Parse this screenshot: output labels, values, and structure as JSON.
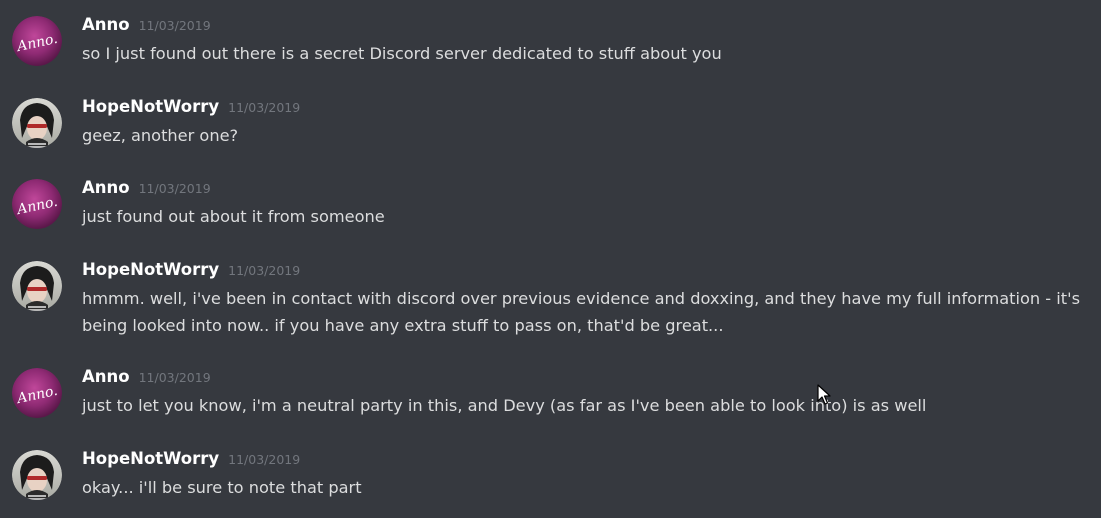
{
  "colors": {
    "background": "#36393f",
    "username": "#ffffff",
    "timestamp": "#72767d",
    "message_text": "#dcddde"
  },
  "messages": [
    {
      "author": "Anno",
      "avatar_icon": "anno-avatar-icon",
      "avatar_text": "Anno.",
      "timestamp": "11/03/2019",
      "text": "so I just found out there is a secret Discord server dedicated to stuff about you"
    },
    {
      "author": "HopeNotWorry",
      "avatar_icon": "hopenotworry-avatar-icon",
      "timestamp": "11/03/2019",
      "text": "geez, another one?"
    },
    {
      "author": "Anno",
      "avatar_icon": "anno-avatar-icon",
      "avatar_text": "Anno.",
      "timestamp": "11/03/2019",
      "text": "just found out about it from someone"
    },
    {
      "author": "HopeNotWorry",
      "avatar_icon": "hopenotworry-avatar-icon",
      "timestamp": "11/03/2019",
      "text": "hmmm. well, i've been in contact with discord over previous evidence and doxxing, and they have my full information - it's being looked into now.. if you have any extra stuff to pass on, that'd be great..."
    },
    {
      "author": "Anno",
      "avatar_icon": "anno-avatar-icon",
      "avatar_text": "Anno.",
      "timestamp": "11/03/2019",
      "text": "just to let you know, i'm a neutral party in this, and Devy (as far as I've been able to look into) is as well"
    },
    {
      "author": "HopeNotWorry",
      "avatar_icon": "hopenotworry-avatar-icon",
      "timestamp": "11/03/2019",
      "text": "okay... i'll be sure to note that part"
    }
  ]
}
